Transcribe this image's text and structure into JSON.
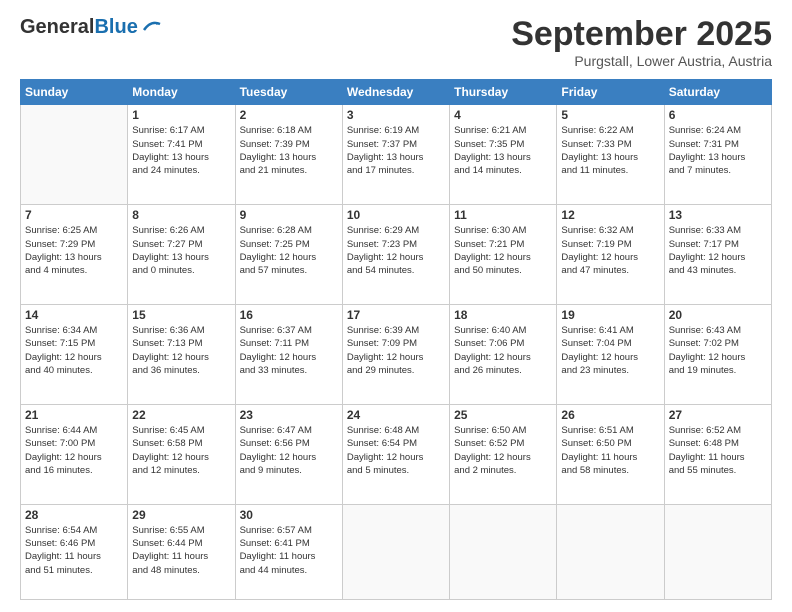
{
  "logo": {
    "general": "General",
    "blue": "Blue"
  },
  "header": {
    "month": "September 2025",
    "location": "Purgstall, Lower Austria, Austria"
  },
  "weekdays": [
    "Sunday",
    "Monday",
    "Tuesday",
    "Wednesday",
    "Thursday",
    "Friday",
    "Saturday"
  ],
  "weeks": [
    [
      {
        "day": "",
        "info": ""
      },
      {
        "day": "1",
        "info": "Sunrise: 6:17 AM\nSunset: 7:41 PM\nDaylight: 13 hours\nand 24 minutes."
      },
      {
        "day": "2",
        "info": "Sunrise: 6:18 AM\nSunset: 7:39 PM\nDaylight: 13 hours\nand 21 minutes."
      },
      {
        "day": "3",
        "info": "Sunrise: 6:19 AM\nSunset: 7:37 PM\nDaylight: 13 hours\nand 17 minutes."
      },
      {
        "day": "4",
        "info": "Sunrise: 6:21 AM\nSunset: 7:35 PM\nDaylight: 13 hours\nand 14 minutes."
      },
      {
        "day": "5",
        "info": "Sunrise: 6:22 AM\nSunset: 7:33 PM\nDaylight: 13 hours\nand 11 minutes."
      },
      {
        "day": "6",
        "info": "Sunrise: 6:24 AM\nSunset: 7:31 PM\nDaylight: 13 hours\nand 7 minutes."
      }
    ],
    [
      {
        "day": "7",
        "info": "Sunrise: 6:25 AM\nSunset: 7:29 PM\nDaylight: 13 hours\nand 4 minutes."
      },
      {
        "day": "8",
        "info": "Sunrise: 6:26 AM\nSunset: 7:27 PM\nDaylight: 13 hours\nand 0 minutes."
      },
      {
        "day": "9",
        "info": "Sunrise: 6:28 AM\nSunset: 7:25 PM\nDaylight: 12 hours\nand 57 minutes."
      },
      {
        "day": "10",
        "info": "Sunrise: 6:29 AM\nSunset: 7:23 PM\nDaylight: 12 hours\nand 54 minutes."
      },
      {
        "day": "11",
        "info": "Sunrise: 6:30 AM\nSunset: 7:21 PM\nDaylight: 12 hours\nand 50 minutes."
      },
      {
        "day": "12",
        "info": "Sunrise: 6:32 AM\nSunset: 7:19 PM\nDaylight: 12 hours\nand 47 minutes."
      },
      {
        "day": "13",
        "info": "Sunrise: 6:33 AM\nSunset: 7:17 PM\nDaylight: 12 hours\nand 43 minutes."
      }
    ],
    [
      {
        "day": "14",
        "info": "Sunrise: 6:34 AM\nSunset: 7:15 PM\nDaylight: 12 hours\nand 40 minutes."
      },
      {
        "day": "15",
        "info": "Sunrise: 6:36 AM\nSunset: 7:13 PM\nDaylight: 12 hours\nand 36 minutes."
      },
      {
        "day": "16",
        "info": "Sunrise: 6:37 AM\nSunset: 7:11 PM\nDaylight: 12 hours\nand 33 minutes."
      },
      {
        "day": "17",
        "info": "Sunrise: 6:39 AM\nSunset: 7:09 PM\nDaylight: 12 hours\nand 29 minutes."
      },
      {
        "day": "18",
        "info": "Sunrise: 6:40 AM\nSunset: 7:06 PM\nDaylight: 12 hours\nand 26 minutes."
      },
      {
        "day": "19",
        "info": "Sunrise: 6:41 AM\nSunset: 7:04 PM\nDaylight: 12 hours\nand 23 minutes."
      },
      {
        "day": "20",
        "info": "Sunrise: 6:43 AM\nSunset: 7:02 PM\nDaylight: 12 hours\nand 19 minutes."
      }
    ],
    [
      {
        "day": "21",
        "info": "Sunrise: 6:44 AM\nSunset: 7:00 PM\nDaylight: 12 hours\nand 16 minutes."
      },
      {
        "day": "22",
        "info": "Sunrise: 6:45 AM\nSunset: 6:58 PM\nDaylight: 12 hours\nand 12 minutes."
      },
      {
        "day": "23",
        "info": "Sunrise: 6:47 AM\nSunset: 6:56 PM\nDaylight: 12 hours\nand 9 minutes."
      },
      {
        "day": "24",
        "info": "Sunrise: 6:48 AM\nSunset: 6:54 PM\nDaylight: 12 hours\nand 5 minutes."
      },
      {
        "day": "25",
        "info": "Sunrise: 6:50 AM\nSunset: 6:52 PM\nDaylight: 12 hours\nand 2 minutes."
      },
      {
        "day": "26",
        "info": "Sunrise: 6:51 AM\nSunset: 6:50 PM\nDaylight: 11 hours\nand 58 minutes."
      },
      {
        "day": "27",
        "info": "Sunrise: 6:52 AM\nSunset: 6:48 PM\nDaylight: 11 hours\nand 55 minutes."
      }
    ],
    [
      {
        "day": "28",
        "info": "Sunrise: 6:54 AM\nSunset: 6:46 PM\nDaylight: 11 hours\nand 51 minutes."
      },
      {
        "day": "29",
        "info": "Sunrise: 6:55 AM\nSunset: 6:44 PM\nDaylight: 11 hours\nand 48 minutes."
      },
      {
        "day": "30",
        "info": "Sunrise: 6:57 AM\nSunset: 6:41 PM\nDaylight: 11 hours\nand 44 minutes."
      },
      {
        "day": "",
        "info": ""
      },
      {
        "day": "",
        "info": ""
      },
      {
        "day": "",
        "info": ""
      },
      {
        "day": "",
        "info": ""
      }
    ]
  ]
}
